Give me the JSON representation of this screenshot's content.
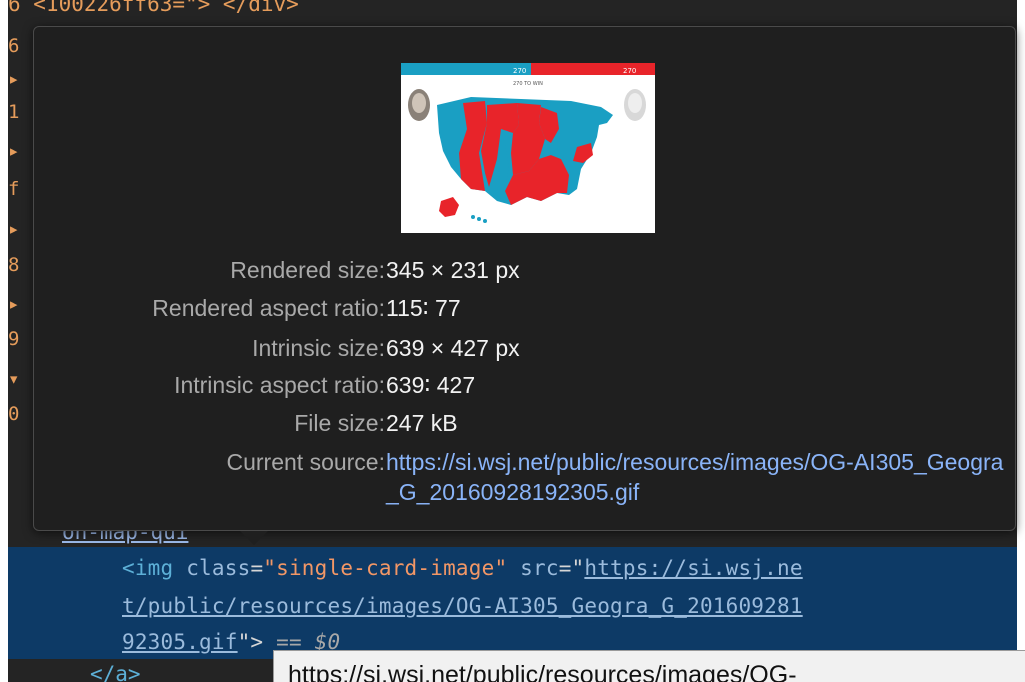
{
  "code_above": {
    "top_partial": "6 <100226ff63=\"> </div>",
    "gutter": [
      "6",
      "▸",
      "1",
      "▸",
      "f",
      "▸",
      "8",
      "▸",
      "9",
      "▾",
      "0"
    ],
    "below_link": "on-map-qui"
  },
  "tooltip": {
    "rows": [
      {
        "label": "Rendered size:",
        "value": "345 × 231 px"
      },
      {
        "label": "Rendered aspect ratio:",
        "value": "115∶ 77"
      },
      {
        "label": "Intrinsic size:",
        "value": "639 × 427 px"
      },
      {
        "label": "Intrinsic aspect ratio:",
        "value": "639∶ 427"
      },
      {
        "label": "File size:",
        "value": "247 kB"
      }
    ],
    "source_label": "Current source:",
    "source_value": "https://si.wsj.net/public/resources/images/OG-AI305_Geogra_G_20160928192305.gif",
    "preview": {
      "bar_left_text": "270",
      "bar_right_text": "270",
      "bar_center_text": "270 TO WIN",
      "blue_color": "#1a9fc3",
      "red_color": "#e8242a"
    }
  },
  "selected_element": {
    "line1": {
      "tag_open": "<img",
      "class_attr": "class",
      "class_val": "\"single-card-image\"",
      "src_attr": "src",
      "src_start": "https://si.wsj.ne"
    },
    "line2": "t/public/resources/images/OG-AI305_Geogra_G_201609281",
    "line3_link": "92305.gif",
    "line3_close": "\">",
    "line3_eq": "==",
    "line3_dollar": "$0"
  },
  "closing_tag": "</a>",
  "url_tooltip": "https://si.wsj.net/public/resources/images/OG-"
}
